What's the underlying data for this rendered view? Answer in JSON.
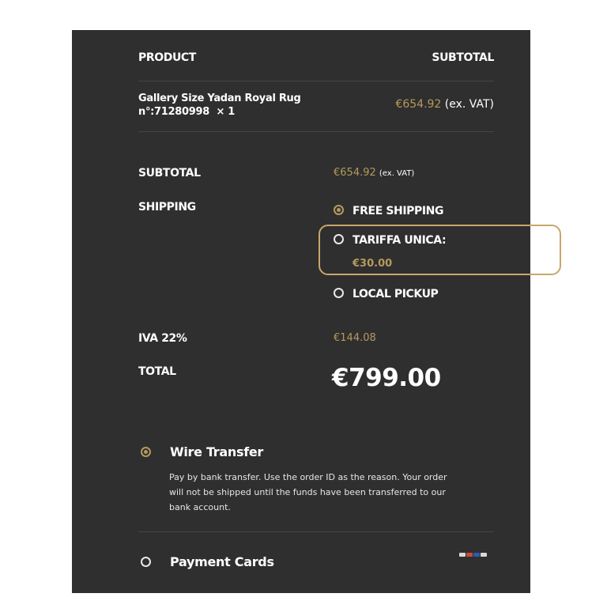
{
  "table": {
    "product_header": "PRODUCT",
    "subtotal_header": "SUBTOTAL",
    "item": {
      "name_line1": "Gallery Size Yadan Royal Rug",
      "name_line2": "n°:71280998",
      "qty": "× 1",
      "price": "€654.92",
      "price_note": "(ex. VAT)"
    }
  },
  "totals": {
    "subtotal_label": "SUBTOTAL",
    "subtotal_value": "€654.92",
    "subtotal_note": "(ex. VAT)",
    "shipping_label": "SHIPPING",
    "shipping_options": [
      {
        "label": "FREE SHIPPING",
        "checked": true
      },
      {
        "label": "TARIFFA UNICA:",
        "price": "€30.00",
        "checked": false
      },
      {
        "label": "LOCAL PICKUP",
        "checked": false
      }
    ],
    "vat_label": "IVA 22%",
    "vat_value": "€144.08",
    "total_label": "TOTAL",
    "total_value": "€799.00"
  },
  "payment": {
    "wire": {
      "label": "Wire Transfer",
      "checked": true,
      "description": "Pay by bank transfer. Use the order ID as the reason. Your order will not be shipped until the funds have been transferred to our bank account."
    },
    "cards": {
      "label": "Payment Cards",
      "checked": false,
      "icon": "card-logos-icon"
    }
  },
  "colors": {
    "panel_bg": "#2f2f2f",
    "gold": "#b59a5e",
    "highlight_border": "#c9a66b"
  }
}
